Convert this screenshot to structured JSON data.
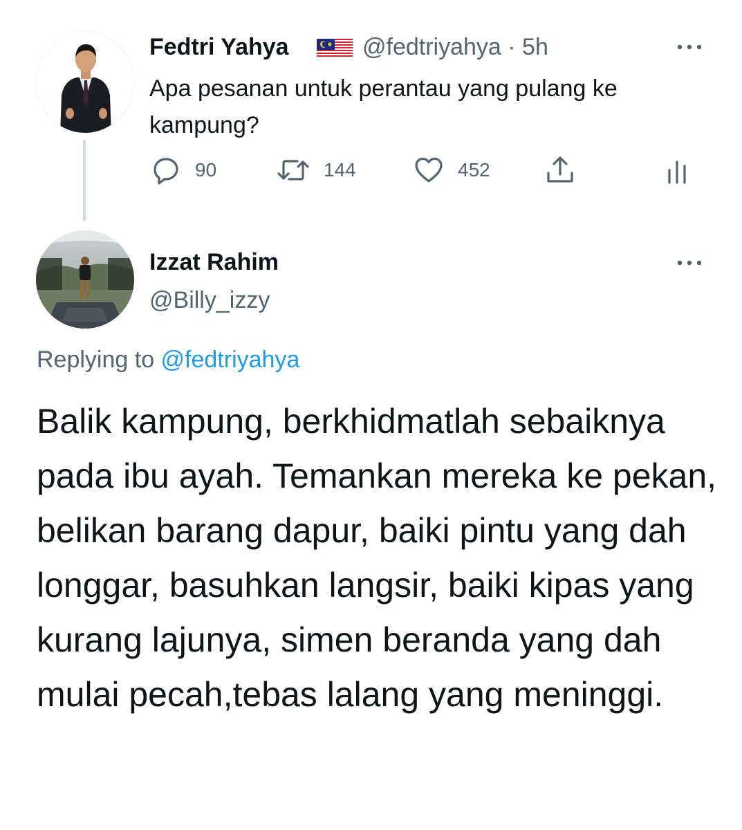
{
  "original_tweet": {
    "author_name": "Fedtri Yahya",
    "author_flag_icon": "malaysia-flag-icon",
    "handle_and_time": "@fedtriyahya · 5h",
    "text": "Apa pesanan untuk perantau yang pulang ke kampung?",
    "actions": {
      "reply_count": "90",
      "retweet_count": "144",
      "like_count": "452"
    }
  },
  "reply_tweet": {
    "author_name": "Izzat Rahim",
    "handle": "@Billy_izzy",
    "replying_prefix": "Replying to ",
    "replying_to": "@fedtriyahya",
    "text": "Balik kampung, berkhidmatlah sebaiknya pada ibu ayah. Temankan mereka ke pekan, belikan barang dapur, baiki pintu yang dah longgar, basuhkan langsir, baiki kipas yang kurang lajunya, simen beranda yang dah mulai pecah,tebas lalang yang meninggi."
  },
  "colors": {
    "text_primary": "#0f1419",
    "text_secondary": "#536471",
    "link": "#1d9bf0",
    "thread_line": "#cfd9de"
  }
}
